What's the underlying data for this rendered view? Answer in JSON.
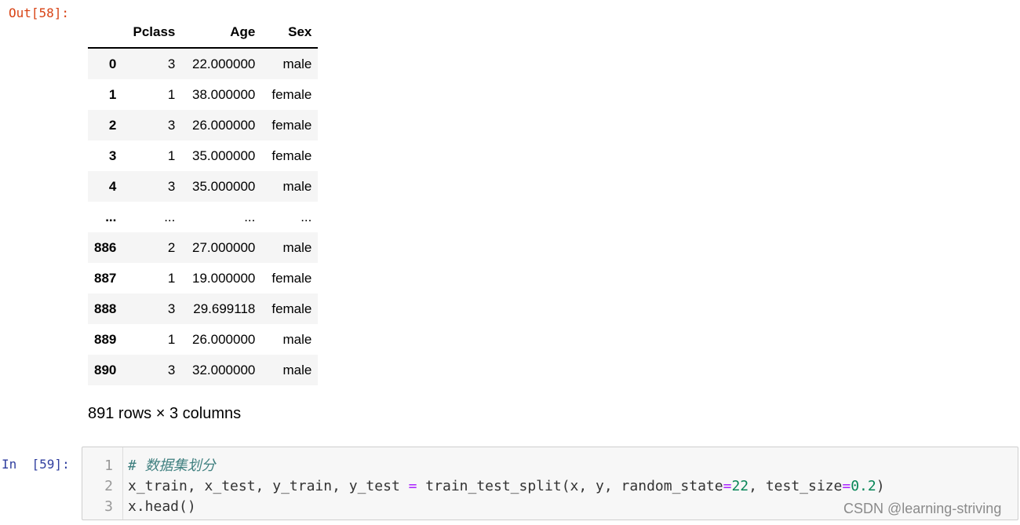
{
  "out_prompt": "Out[58]:",
  "in_prompt": "In  [59]:",
  "dataframe": {
    "columns": [
      "",
      "Pclass",
      "Age",
      "Sex"
    ],
    "rows": [
      {
        "index": "0",
        "pclass": "3",
        "age": "22.000000",
        "sex": "male"
      },
      {
        "index": "1",
        "pclass": "1",
        "age": "38.000000",
        "sex": "female"
      },
      {
        "index": "2",
        "pclass": "3",
        "age": "26.000000",
        "sex": "female"
      },
      {
        "index": "3",
        "pclass": "1",
        "age": "35.000000",
        "sex": "female"
      },
      {
        "index": "4",
        "pclass": "3",
        "age": "35.000000",
        "sex": "male"
      },
      {
        "index": "...",
        "pclass": "...",
        "age": "...",
        "sex": "..."
      },
      {
        "index": "886",
        "pclass": "2",
        "age": "27.000000",
        "sex": "male"
      },
      {
        "index": "887",
        "pclass": "1",
        "age": "19.000000",
        "sex": "female"
      },
      {
        "index": "888",
        "pclass": "3",
        "age": "29.699118",
        "sex": "female"
      },
      {
        "index": "889",
        "pclass": "1",
        "age": "26.000000",
        "sex": "male"
      },
      {
        "index": "890",
        "pclass": "3",
        "age": "32.000000",
        "sex": "male"
      }
    ],
    "shape_text": "891 rows × 3 columns"
  },
  "code_cell": {
    "line_numbers": [
      "1",
      "2",
      "3"
    ],
    "line1_comment": "# 数据集划分",
    "line2": {
      "lhs": "x_train, x_test, y_train, y_test ",
      "eq": "=",
      "call": " train_test_split(x, y, random_state",
      "eq2": "=",
      "num1": "22",
      "mid": ", test_size",
      "eq3": "=",
      "num2": "0.2",
      "end": ")"
    },
    "line3": "x.head()"
  },
  "watermark": "CSDN @learning-striving"
}
